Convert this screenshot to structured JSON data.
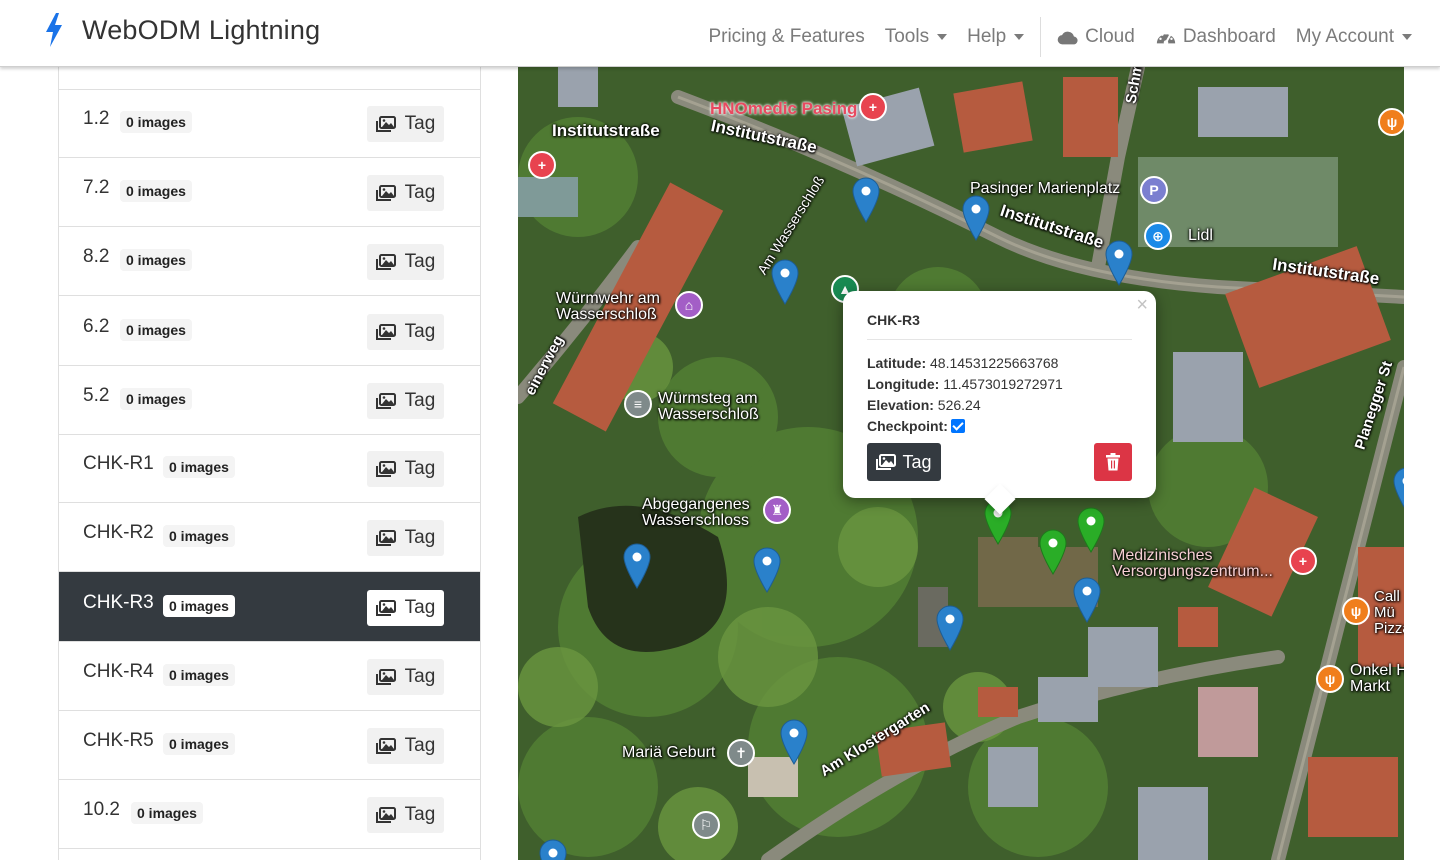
{
  "header": {
    "brand": "WebODM Lightning",
    "nav": {
      "pricing": "Pricing & Features",
      "tools": "Tools",
      "help": "Help",
      "cloud": "Cloud",
      "dashboard": "Dashboard",
      "account": "My Account"
    }
  },
  "points": [
    {
      "label": "1.2",
      "images": "0 images",
      "tag": "Tag"
    },
    {
      "label": "7.2",
      "images": "0 images",
      "tag": "Tag"
    },
    {
      "label": "8.2",
      "images": "0 images",
      "tag": "Tag"
    },
    {
      "label": "6.2",
      "images": "0 images",
      "tag": "Tag"
    },
    {
      "label": "5.2",
      "images": "0 images",
      "tag": "Tag"
    },
    {
      "label": "CHK-R1",
      "images": "0 images",
      "tag": "Tag"
    },
    {
      "label": "CHK-R2",
      "images": "0 images",
      "tag": "Tag"
    },
    {
      "label": "CHK-R3",
      "images": "0 images",
      "tag": "Tag",
      "active": true
    },
    {
      "label": "CHK-R4",
      "images": "0 images",
      "tag": "Tag"
    },
    {
      "label": "CHK-R5",
      "images": "0 images",
      "tag": "Tag"
    },
    {
      "label": "10.2",
      "images": "0 images",
      "tag": "Tag"
    }
  ],
  "popup": {
    "title": "CHK-R3",
    "close": "×",
    "latitude_label": "Latitude:",
    "latitude": "48.14531225663768",
    "longitude_label": "Longitude:",
    "longitude": "11.4573019272971",
    "elevation_label": "Elevation:",
    "elevation": "526.24",
    "checkpoint_label": "Checkpoint:",
    "checkpoint": true,
    "tag_label": "Tag"
  },
  "map_labels": {
    "institut1": "Institutstraße",
    "institut2": "Institutstraße",
    "institut3": "Institutstraße",
    "institut4": "Institutstraße",
    "hnomedic": "HNOmedic Pasing",
    "marienplatz": "Pasinger Marienplatz",
    "lidl": "Lidl",
    "wuermwehr": "Würmwehr am\nWasserschloß",
    "amwasserschloss": "Am Wasserschloß",
    "wuermsteg": "Würmsteg am\nWasserschloß",
    "einerweg": "einerweg",
    "abgegangenes": "Abgegangenes\nWasserschloss",
    "medizinisches": "Medizinisches\nVersorgungszentrum...",
    "planegger": "Planegger St",
    "mariae": "Mariä Geburt",
    "klostergarten": "Am Klostergarten",
    "onkel": "Onkel H\nMarkt",
    "call": "Call\nMü\nPizza",
    "schm": "Schm"
  },
  "colors": {
    "marker_blue": "#2a81cb",
    "marker_green": "#2aad27",
    "active_row": "#343a40",
    "delete": "#dc3545",
    "brand_bolt": "#1a73e8"
  }
}
